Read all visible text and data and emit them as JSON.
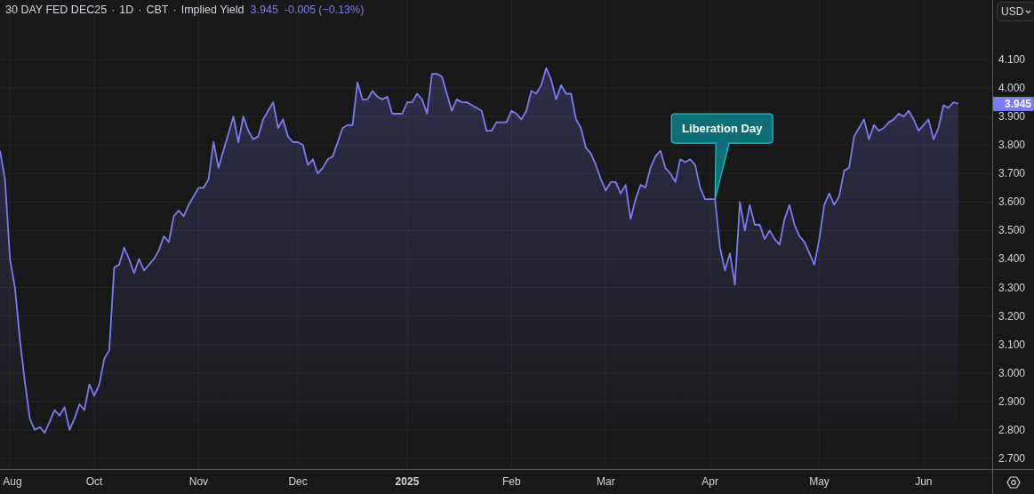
{
  "header": {
    "parts": [
      "30 DAY FED DEC25",
      "1D",
      "CBT",
      "Implied Yield"
    ],
    "separator": "·",
    "last": "3.945",
    "change": "-0.005",
    "change_pct": "(−0.13%)"
  },
  "price_axis": {
    "currency": "USD",
    "last_price": "3.945"
  },
  "chart_data": {
    "type": "area",
    "grid": true,
    "ylim": [
      2.6625,
      4.309
    ],
    "categories": [
      null,
      null,
      "Aug",
      null,
      null,
      null,
      null,
      null,
      null,
      null,
      null,
      null,
      null,
      null,
      null,
      null,
      null,
      null,
      null,
      "Oct",
      null,
      null,
      null,
      null,
      null,
      null,
      null,
      null,
      null,
      null,
      null,
      null,
      null,
      null,
      null,
      null,
      null,
      null,
      null,
      null,
      "Nov",
      null,
      null,
      null,
      null,
      null,
      null,
      null,
      null,
      null,
      null,
      null,
      null,
      null,
      null,
      null,
      null,
      null,
      null,
      null,
      "Dec",
      null,
      null,
      null,
      null,
      null,
      null,
      null,
      null,
      null,
      null,
      null,
      null,
      null,
      null,
      null,
      null,
      null,
      null,
      null,
      null,
      null,
      "2025",
      null,
      null,
      null,
      null,
      null,
      null,
      null,
      null,
      null,
      null,
      null,
      null,
      null,
      null,
      null,
      null,
      null,
      null,
      null,
      null,
      "Feb",
      null,
      null,
      null,
      null,
      null,
      null,
      null,
      null,
      null,
      null,
      null,
      null,
      null,
      null,
      null,
      null,
      null,
      null,
      "Mar",
      null,
      null,
      null,
      null,
      null,
      null,
      null,
      null,
      null,
      null,
      null,
      null,
      null,
      null,
      null,
      null,
      null,
      null,
      null,
      null,
      "Apr",
      null,
      null,
      null,
      null,
      null,
      null,
      null,
      null,
      null,
      null,
      null,
      null,
      null,
      null,
      null,
      null,
      null,
      null,
      null,
      null,
      null,
      "May",
      null,
      null,
      null,
      null,
      null,
      null,
      null,
      null,
      null,
      null,
      null,
      null,
      null,
      null,
      null,
      null,
      null,
      null,
      null,
      null,
      "Jun",
      null,
      null,
      null,
      null,
      null,
      null,
      null
    ],
    "series": [
      {
        "color": "#7b7bf5",
        "values": [
          3.78,
          3.68,
          3.4,
          3.3,
          3.12,
          2.97,
          2.84,
          2.8,
          2.81,
          2.79,
          2.83,
          2.87,
          2.85,
          2.88,
          2.8,
          2.84,
          2.89,
          2.87,
          2.96,
          2.92,
          2.96,
          3.05,
          3.08,
          3.37,
          3.38,
          3.44,
          3.4,
          3.35,
          3.4,
          3.36,
          3.38,
          3.4,
          3.43,
          3.48,
          3.46,
          3.55,
          3.57,
          3.55,
          3.59,
          3.62,
          3.65,
          3.65,
          3.68,
          3.81,
          3.72,
          3.78,
          3.84,
          3.9,
          3.81,
          3.9,
          3.85,
          3.82,
          3.83,
          3.89,
          3.92,
          3.95,
          3.86,
          3.89,
          3.83,
          3.81,
          3.81,
          3.8,
          3.73,
          3.75,
          3.7,
          3.72,
          3.75,
          3.76,
          3.81,
          3.86,
          3.87,
          3.87,
          4.02,
          3.96,
          3.96,
          3.99,
          3.97,
          3.96,
          3.97,
          3.91,
          3.91,
          3.91,
          3.95,
          3.95,
          3.98,
          3.96,
          3.91,
          4.05,
          4.05,
          4.04,
          3.98,
          3.92,
          3.96,
          3.95,
          3.95,
          3.94,
          3.93,
          3.92,
          3.85,
          3.85,
          3.88,
          3.88,
          3.88,
          3.92,
          3.91,
          3.89,
          3.92,
          3.99,
          3.98,
          4.01,
          4.07,
          4.03,
          3.96,
          4.01,
          3.98,
          3.98,
          3.89,
          3.86,
          3.79,
          3.77,
          3.73,
          3.68,
          3.64,
          3.67,
          3.67,
          3.63,
          3.66,
          3.54,
          3.61,
          3.66,
          3.65,
          3.72,
          3.76,
          3.78,
          3.72,
          3.7,
          3.67,
          3.75,
          3.74,
          3.75,
          3.73,
          3.65,
          3.61,
          3.61,
          3.61,
          3.44,
          3.36,
          3.42,
          3.31,
          3.6,
          3.5,
          3.59,
          3.52,
          3.52,
          3.47,
          3.5,
          3.47,
          3.45,
          3.54,
          3.59,
          3.52,
          3.48,
          3.46,
          3.42,
          3.38,
          3.47,
          3.59,
          3.63,
          3.59,
          3.62,
          3.71,
          3.72,
          3.83,
          3.86,
          3.89,
          3.82,
          3.87,
          3.85,
          3.86,
          3.88,
          3.89,
          3.91,
          3.9,
          3.92,
          3.89,
          3.85,
          3.87,
          3.89,
          3.82,
          3.86,
          3.94,
          3.93,
          3.95,
          3.945
        ]
      }
    ],
    "yticks": [
      {
        "value": 4.1,
        "label": "4.100"
      },
      {
        "value": 4.0,
        "label": "4.000"
      },
      {
        "value": 3.9,
        "label": "3.900"
      },
      {
        "value": 3.8,
        "label": "3.800"
      },
      {
        "value": 3.7,
        "label": "3.700"
      },
      {
        "value": 3.6,
        "label": "3.600"
      },
      {
        "value": 3.5,
        "label": "3.500"
      },
      {
        "value": 3.4,
        "label": "3.400"
      },
      {
        "value": 3.3,
        "label": "3.300"
      },
      {
        "value": 3.2,
        "label": "3.200"
      },
      {
        "value": 3.1,
        "label": "3.100"
      },
      {
        "value": 3.0,
        "label": "3.000"
      },
      {
        "value": 2.9,
        "label": "2.900"
      },
      {
        "value": 2.8,
        "label": "2.800"
      },
      {
        "value": 2.7,
        "label": "2.700"
      }
    ],
    "annotations": [
      "Liberation Day"
    ]
  }
}
